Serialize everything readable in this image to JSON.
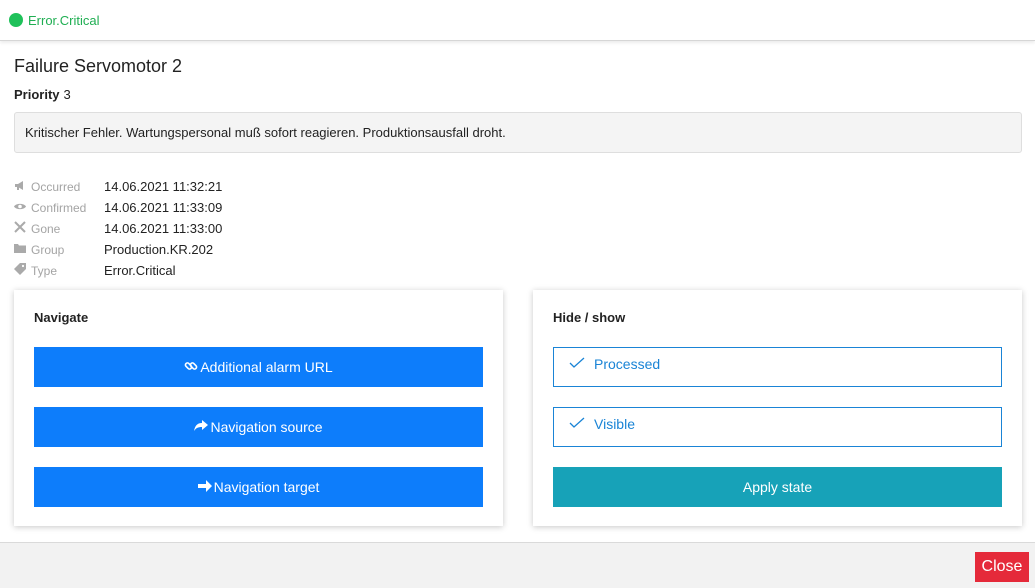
{
  "header": {
    "status_text": "Error.Critical",
    "status_color": "#1fc15a"
  },
  "alarm": {
    "title": "Failure Servomotor 2",
    "priority_label": "Priority",
    "priority_value": "3",
    "description": "Kritischer Fehler. Wartungspersonal muß sofort reagieren. Produktionsausfall droht."
  },
  "details": [
    {
      "icon": "megaphone-icon",
      "label": "Occurred",
      "value": "14.06.2021 11:32:21"
    },
    {
      "icon": "eye-icon",
      "label": "Confirmed",
      "value": "14.06.2021 11:33:09"
    },
    {
      "icon": "tools-icon",
      "label": "Gone",
      "value": "14.06.2021 11:33:00"
    },
    {
      "icon": "folder-icon",
      "label": "Group",
      "value": "Production.KR.202"
    },
    {
      "icon": "tag-icon",
      "label": "Type",
      "value": "Error.Critical"
    }
  ],
  "navigate": {
    "title": "Navigate",
    "buttons": [
      {
        "icon": "link-icon",
        "label": "Additional alarm URL"
      },
      {
        "icon": "share-icon",
        "label": "Navigation source"
      },
      {
        "icon": "arrow-right-icon",
        "label": "Navigation target"
      }
    ],
    "button_color": "#0d7dfb"
  },
  "hide_show": {
    "title": "Hide / show",
    "options": [
      {
        "label": "Processed",
        "checked": true
      },
      {
        "label": "Visible",
        "checked": true
      }
    ],
    "apply_label": "Apply state",
    "apply_color": "#17a2b8"
  },
  "footer": {
    "close_label": "Close",
    "close_color": "#e52a3a"
  }
}
